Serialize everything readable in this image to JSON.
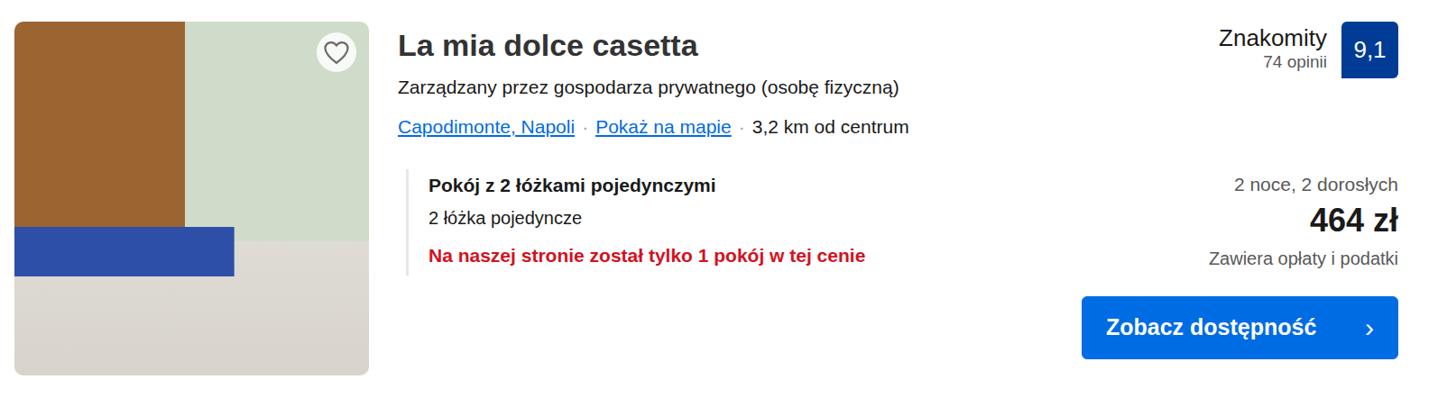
{
  "listing": {
    "title": "La mia dolce casetta",
    "favorite": false,
    "host": "Zarządzany przez gospodarza prywatnego (osobę fizyczną)",
    "location": "Capodimonte, Napoli",
    "map_link": "Pokaż na mapie",
    "separator": "·",
    "distance": "3,2 km od centrum"
  },
  "rating": {
    "label": "Znakomity",
    "reviews": "74 opinii",
    "score": "9,1"
  },
  "room": {
    "name": "Pokój z 2 łóżkami pojedynczymi",
    "beds": "2 łóżka pojedyncze",
    "alert": "Na naszej stronie został tylko 1 pokój w tej cenie"
  },
  "price": {
    "stay": "2 noce, 2 dorosłych",
    "amount": "464 zł",
    "note": "Zawiera opłaty i podatki"
  },
  "button": {
    "label": "Zobacz dostępność",
    "arrow": "›"
  }
}
